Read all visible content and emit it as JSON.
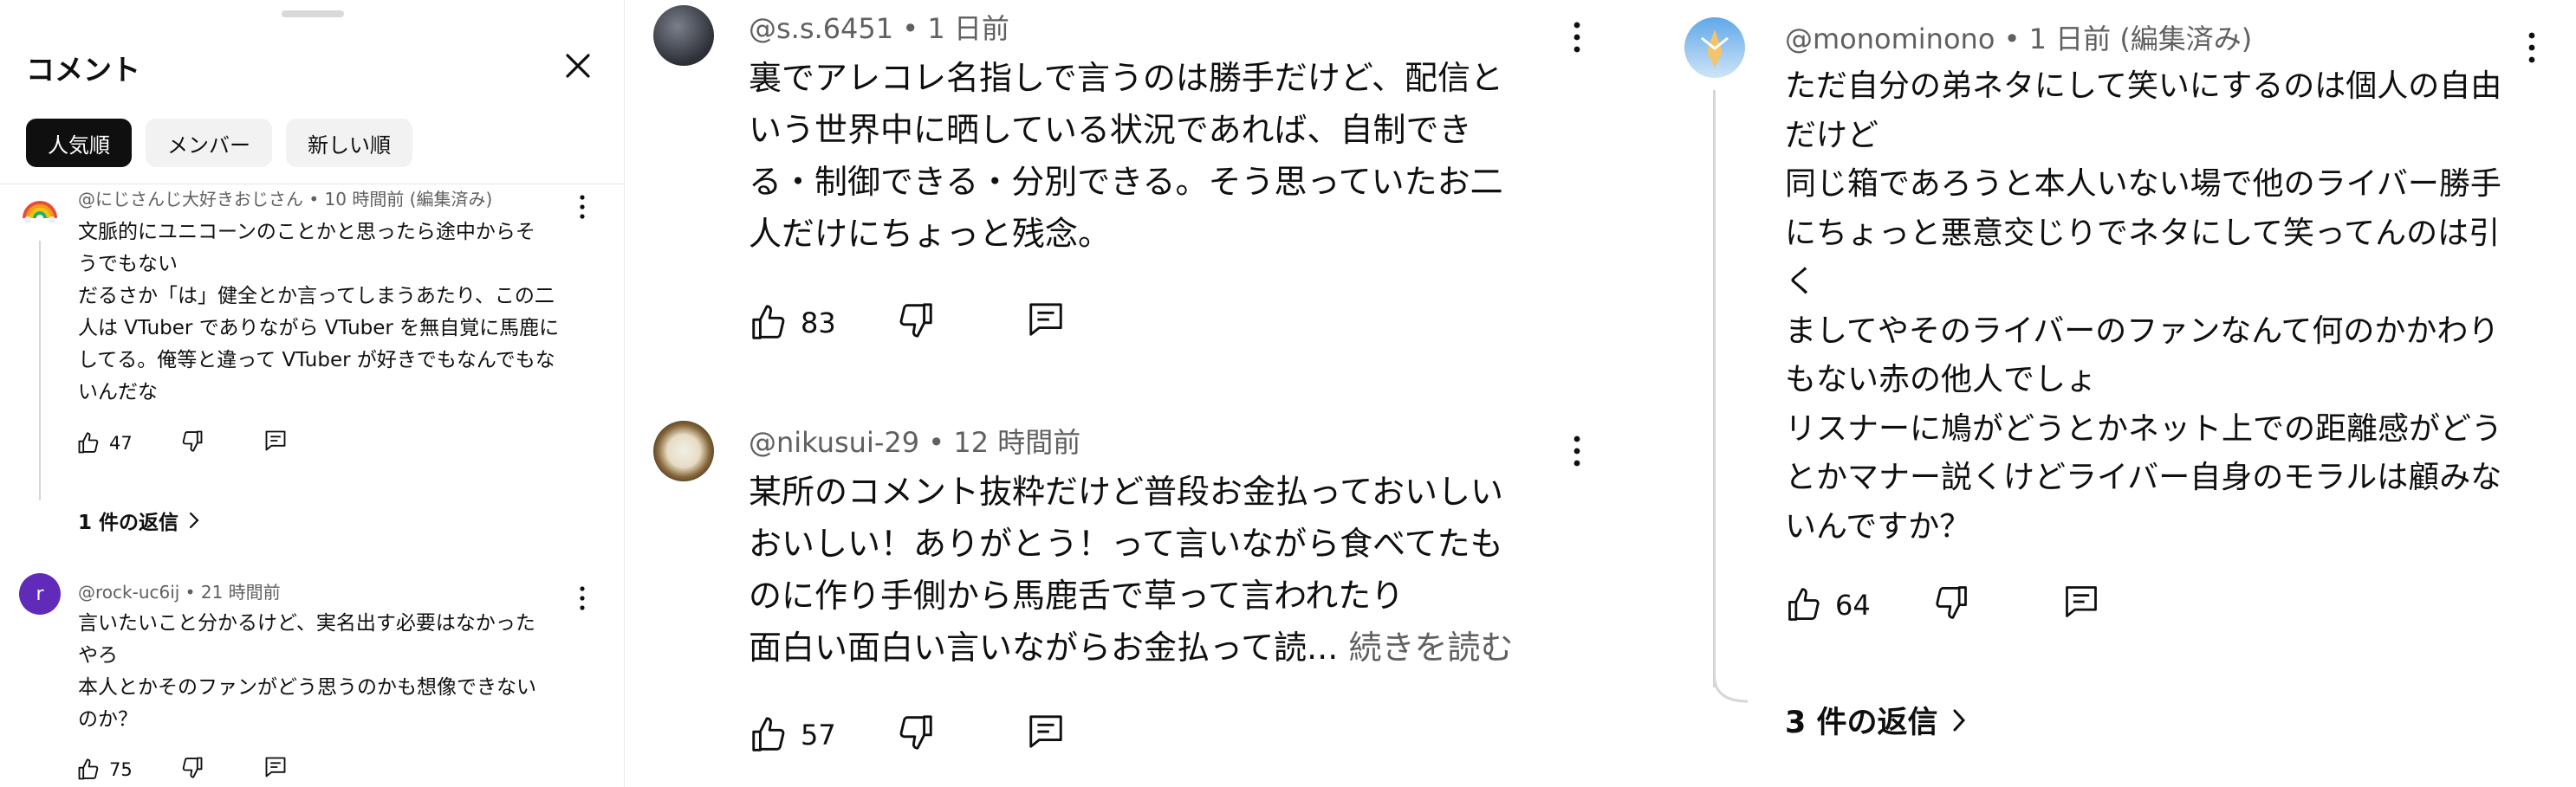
{
  "panel_left": {
    "title": "コメント",
    "tabs": [
      "人気順",
      "メンバー",
      "新しい順"
    ],
    "comments": [
      {
        "author": "@にじさんじ大好きおじさん",
        "time": "10 時間前 (編集済み)",
        "lines": [
          "文脈的にユニコーンのことかと思ったら途中からそ",
          "うでもない",
          "だるさか「は」健全とか言ってしまうあたり、この二",
          "人は VTuber でありながら VTuber を無自覚に馬鹿に",
          "してる。俺等と違って VTuber が好きでもなんでもな",
          "いんだな"
        ],
        "likes": "47",
        "replies": "1 件の返信"
      },
      {
        "author": "@rock-uc6ij",
        "time": "21 時間前",
        "avatar_letter": "r",
        "lines": [
          "言いたいこと分かるけど、実名出す必要はなかった",
          "やろ",
          "本人とかそのファンがどう思うのかも想像できない",
          "のか？"
        ],
        "likes": "75"
      }
    ]
  },
  "panel_middle": {
    "comments": [
      {
        "author": "@s.s.6451",
        "time": "1 日前",
        "lines": [
          "裏でアレコレ名指しで言うのは勝手だけど、配信と",
          "いう世界中に晒している状況であれば、自制でき",
          "る・制御できる・分別できる。そう思っていたお二",
          "人だけにちょっと残念。"
        ],
        "likes": "83"
      },
      {
        "author": "@nikusui-29",
        "time": "12 時間前",
        "lines": [
          "某所のコメント抜粋だけど普段お金払っておいしい",
          "おいしい！ありがとう！って言いながら食べてたも",
          "のに作り手側から馬鹿舌で草って言われたり",
          "面白い面白い言いながらお金払って読..."
        ],
        "read_more": "続きを読む",
        "likes": "57"
      }
    ]
  },
  "panel_right": {
    "comments": [
      {
        "author": "@monominono",
        "time": "1 日前 (編集済み)",
        "lines": [
          "ただ自分の弟ネタにして笑いにするのは個人の自由",
          "だけど",
          "同じ箱であろうと本人いない場で他のライバー勝手",
          "にちょっと悪意交じりでネタにして笑ってんのは引",
          "く",
          "ましてやそのライバーのファンなんて何のかかわり",
          "もない赤の他人でしょ",
          "リスナーに鳩がどうとかネット上での距離感がどう",
          "とかマナー説くけどライバー自身のモラルは顧みな",
          "いんですか？"
        ],
        "likes": "64",
        "replies": "3 件の返信"
      }
    ]
  },
  "icons": {
    "close": "close-icon",
    "kebab": "more-vert-icon",
    "like": "thumb-up-icon",
    "dislike": "thumb-down-icon",
    "reply": "reply-comment-icon",
    "chevron": "chevron-right-icon"
  },
  "colors": {
    "text": "#0f0f0f",
    "meta": "#606060",
    "chip_active_bg": "#0f0f0f",
    "chip_bg": "#f2f2f2",
    "avatar_r": "#5f2bb8"
  }
}
